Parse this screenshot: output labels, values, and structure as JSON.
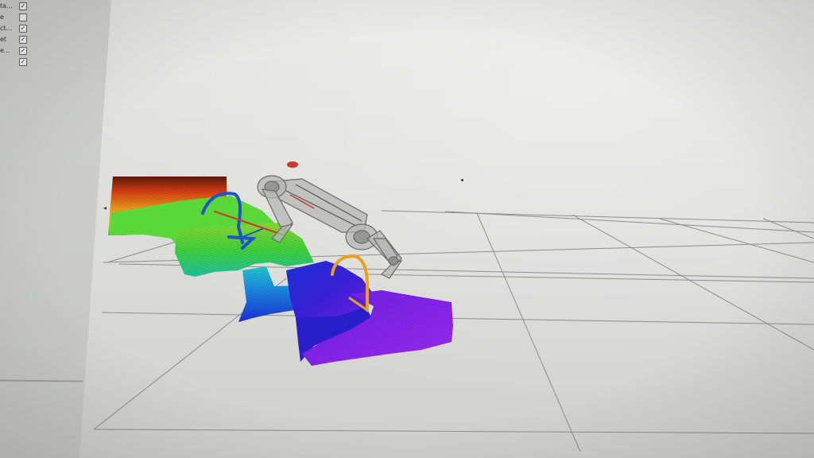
{
  "properties_panel": {
    "rows": [
      {
        "label": "ta...",
        "checked": true
      },
      {
        "label": "e",
        "checked": false
      },
      {
        "label": "ct...",
        "checked": true
      },
      {
        "label": "et",
        "checked": true
      },
      {
        "label": "e...",
        "checked": true
      },
      {
        "label": "",
        "checked": true
      }
    ]
  },
  "viewport": {
    "scene": "robot-stair-heightmap",
    "grid": true
  },
  "icons": {
    "collapse": "collapse-arrow-icon",
    "checkbox": "checkbox-icon"
  },
  "colors": {
    "background": "#dcdcd9",
    "grid": "#8e8e8c",
    "heightmap_top": "#d23a12",
    "heightmap_mid": "#3fcf3a",
    "heightmap_low": "#1a2fd6",
    "heightmap_bottom": "#7a1fe0",
    "robot_body": "#9a9a9a",
    "leg_trajectory_blue": "#1f54c8",
    "leg_trajectory_orange": "#e8a020",
    "marker_red": "#c83a2a"
  }
}
